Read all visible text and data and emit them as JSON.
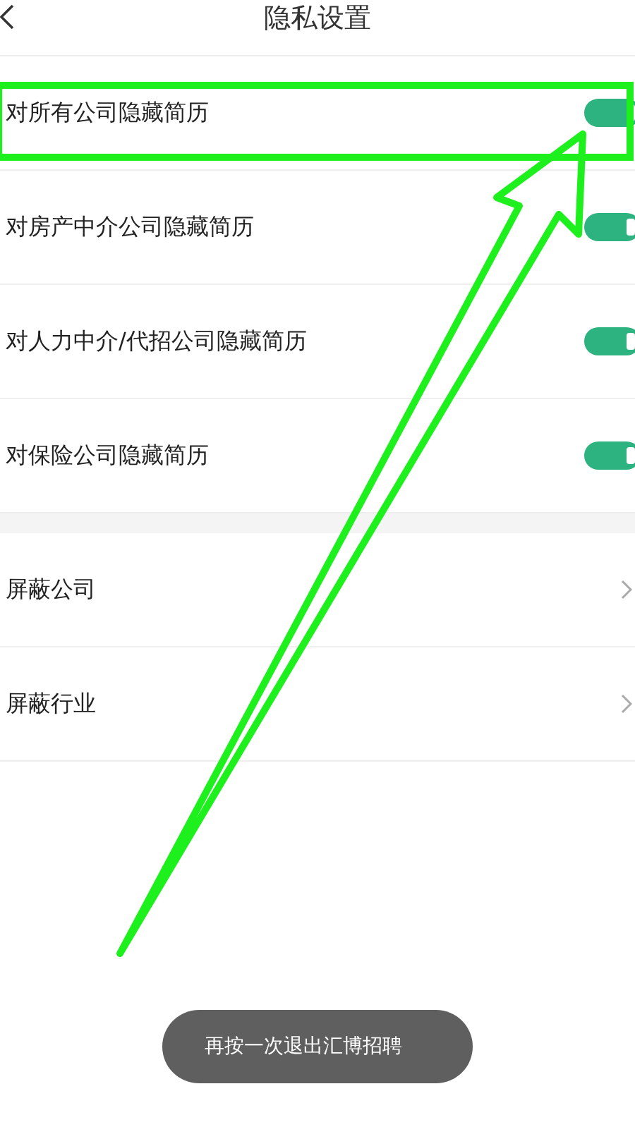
{
  "header": {
    "title": "隐私设置"
  },
  "toggles": [
    {
      "label": "对所有公司隐藏简历",
      "on": true
    },
    {
      "label": "对房产中介公司隐藏简历",
      "on": true
    },
    {
      "label": "对人力中介/代招公司隐藏简历",
      "on": true
    },
    {
      "label": "对保险公司隐藏简历",
      "on": true
    }
  ],
  "links": [
    {
      "label": "屏蔽公司"
    },
    {
      "label": "屏蔽行业"
    }
  ],
  "toast": "再按一次退出汇博招聘"
}
